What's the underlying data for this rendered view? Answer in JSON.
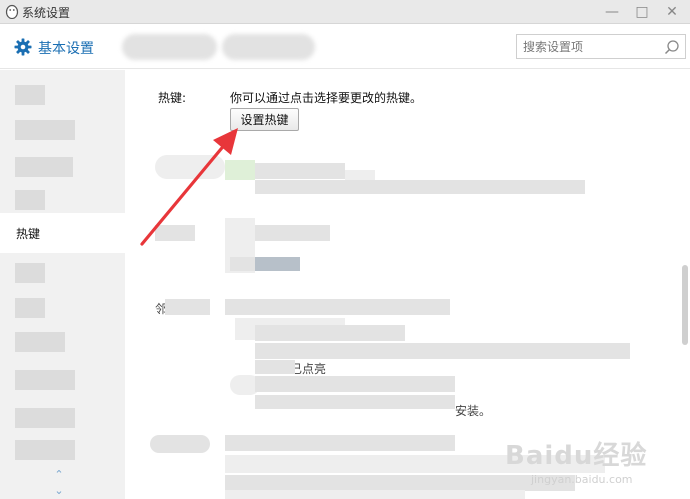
{
  "window": {
    "title": "系统设置",
    "controls": {
      "minimize": "—",
      "maximize": "□",
      "close": "✕"
    }
  },
  "header": {
    "section_title": "基本设置",
    "search": {
      "placeholder": "搜索设置项",
      "value": ""
    }
  },
  "sidebar": {
    "active_item": "热键",
    "scroll_up": "⌃",
    "scroll_down": "⌄"
  },
  "content": {
    "hotkey_label": "热键:",
    "hotkey_description": "你可以通过点击选择要更改的热键。",
    "hotkey_button": "设置热键",
    "fragments": {
      "f1": "已点亮",
      "f2": "安装。",
      "f3": "邻"
    }
  },
  "watermark": {
    "brand": "Baidu经验",
    "url": "jingyan.baidu.com"
  },
  "colors": {
    "accent": "#1b6fb3",
    "annotation_arrow": "#e8363a",
    "sidebar_bg": "#f1f1f1"
  },
  "icons": {
    "app": "penguin-icon",
    "section": "gear-icon",
    "search": "search-icon"
  }
}
